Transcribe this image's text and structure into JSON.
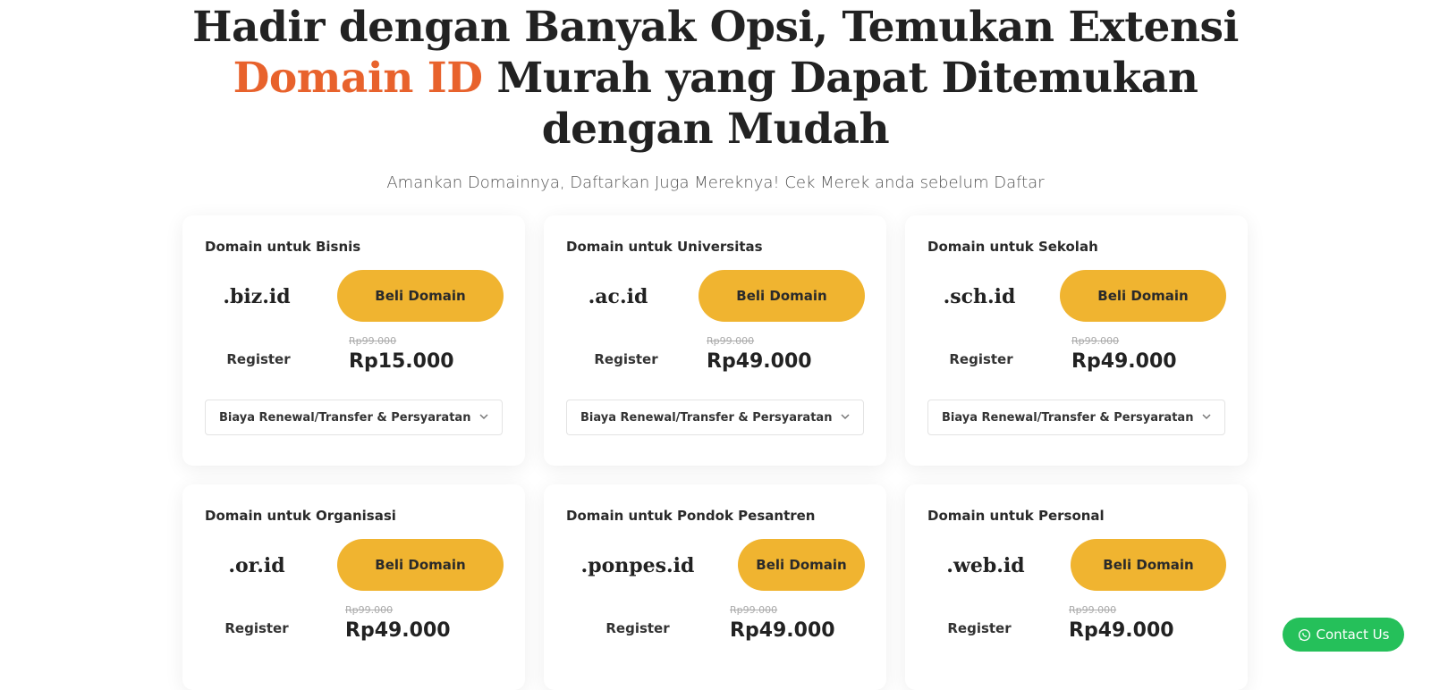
{
  "hero": {
    "title_line1": "Hadir dengan Banyak Opsi, Temukan Extensi",
    "title_accent": "Domain ID",
    "title_line2_rest": " Murah yang Dapat Ditemukan",
    "title_line3": "dengan Mudah",
    "accent_color": "#e8622c",
    "subtitle": "Amankan Domainnya, Daftarkan Juga Mereknya! Cek Merek anda sebelum Daftar"
  },
  "cards": [
    {
      "title": "Domain untuk Bisnis",
      "extension": ".biz.id",
      "button": "Beli Domain",
      "register": "Register",
      "old_price": "Rp99.000",
      "price": "Rp15.000",
      "dropdown": "Biaya Renewal/Transfer & Persyaratan"
    },
    {
      "title": "Domain untuk Universitas",
      "extension": ".ac.id",
      "button": "Beli Domain",
      "register": "Register",
      "old_price": "Rp99.000",
      "price": "Rp49.000",
      "dropdown": "Biaya Renewal/Transfer & Persyaratan"
    },
    {
      "title": "Domain untuk Sekolah",
      "extension": ".sch.id",
      "button": "Beli Domain",
      "register": "Register",
      "old_price": "Rp99.000",
      "price": "Rp49.000",
      "dropdown": "Biaya Renewal/Transfer & Persyaratan"
    },
    {
      "title": "Domain untuk Organisasi",
      "extension": ".or.id",
      "button": "Beli Domain",
      "register": "Register",
      "old_price": "Rp99.000",
      "price": "Rp49.000"
    },
    {
      "title": "Domain untuk Pondok Pesantren",
      "extension": ".ponpes.id",
      "button": "Beli Domain",
      "register": "Register",
      "old_price": "Rp99.000",
      "price": "Rp49.000"
    },
    {
      "title": "Domain untuk Personal",
      "extension": ".web.id",
      "button": "Beli Domain",
      "register": "Register",
      "old_price": "Rp99.000",
      "price": "Rp49.000"
    }
  ],
  "button_color": "#f0b430",
  "contact": {
    "label": "Contact Us",
    "icon": "whatsapp-icon",
    "color": "#25c05a"
  }
}
